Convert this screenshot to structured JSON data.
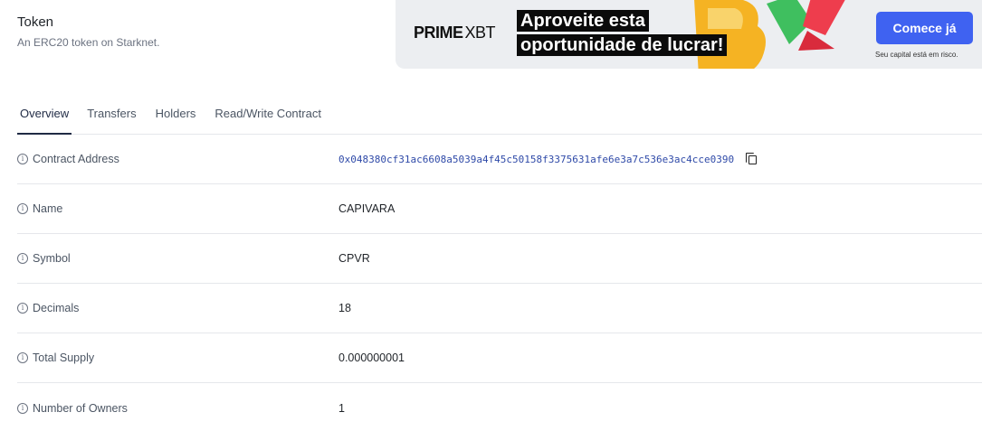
{
  "header": {
    "title": "Token",
    "subtitle": "An ERC20 token on Starknet."
  },
  "ad": {
    "brand_prime": "PRIME",
    "brand_xbt": "XBT",
    "headline_line1": "Aproveite esta",
    "headline_line2": "oportunidade de lucrar!",
    "cta": "Comece já",
    "disclaimer": "Seu capital está em risco.",
    "cta_color": "#3f62f1"
  },
  "tabs": [
    {
      "label": "Overview",
      "active": true
    },
    {
      "label": "Transfers",
      "active": false
    },
    {
      "label": "Holders",
      "active": false
    },
    {
      "label": "Read/Write Contract",
      "active": false
    }
  ],
  "details": {
    "contract_address": {
      "label": "Contract Address",
      "value": "0x048380cf31ac6608a5039a4f45c50158f3375631afe6e3a7c536e3ac4cce0390"
    },
    "name": {
      "label": "Name",
      "value": "CAPIVARA"
    },
    "symbol": {
      "label": "Symbol",
      "value": "CPVR"
    },
    "decimals": {
      "label": "Decimals",
      "value": "18"
    },
    "total_supply": {
      "label": "Total Supply",
      "value": "0.000000001"
    },
    "number_of_owners": {
      "label": "Number of Owners",
      "value": "1"
    }
  },
  "icons": {
    "info": "info-circle-icon",
    "copy": "copy-icon"
  }
}
